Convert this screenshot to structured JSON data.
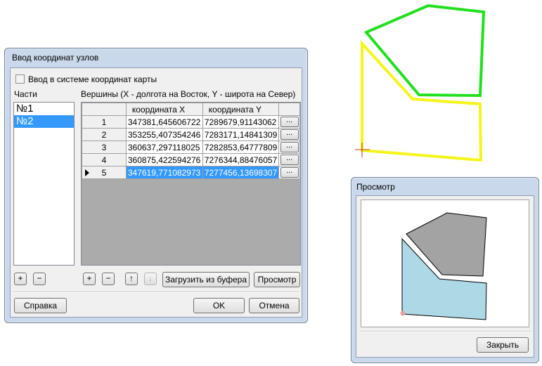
{
  "dialog": {
    "title": "Ввод координат узлов",
    "checkbox_label": "Ввод в системе координат карты",
    "parts_label": "Части",
    "parts": [
      "№1",
      "№2"
    ],
    "vertices_label": "Вершины (X - долгота на Восток, Y - широта на Север)",
    "col_x": "координата X",
    "col_y": "координата Y",
    "rows": [
      {
        "n": "1",
        "x": "347381,645606722",
        "y": "7289679,91143062"
      },
      {
        "n": "2",
        "x": "353255,407354246",
        "y": "7283171,14841309"
      },
      {
        "n": "3",
        "x": "360637,297118025",
        "y": "7282853,64777809"
      },
      {
        "n": "4",
        "x": "360875,422594276",
        "y": "7276344,88476057"
      },
      {
        "n": "5",
        "x": "347619,771082973",
        "y": "7277456,13698307"
      }
    ],
    "ellipsis": "...",
    "plus": "+",
    "minus": "−",
    "up": "↑",
    "down": "↓",
    "load_buffer": "Загрузить из буфера",
    "preview": "Просмотр",
    "help": "Справка",
    "ok": "OK",
    "cancel": "Отмена"
  },
  "preview_window": {
    "title": "Просмотр",
    "close": "Закрыть"
  },
  "colors": {
    "green_polygon": "#22e01e",
    "yellow_polygon": "#f5f51a",
    "gray_fill": "#a3a3a3",
    "blue_fill": "#add8e6",
    "selection": "#3399ff"
  }
}
